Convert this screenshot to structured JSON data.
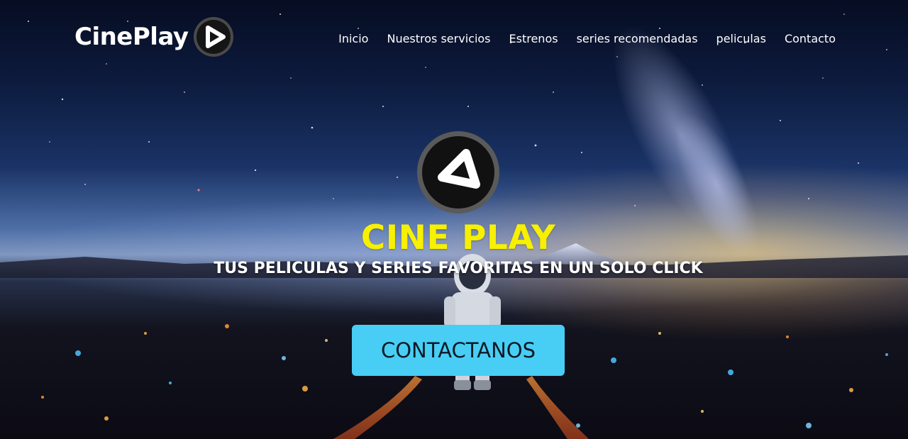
{
  "brand": {
    "name": "CinePlay",
    "logo_icon": "play-triangle-icon"
  },
  "nav": {
    "items": [
      {
        "label": "Inicio"
      },
      {
        "label": "Nuestros servicios"
      },
      {
        "label": "Estrenos"
      },
      {
        "label": "series recomendadas"
      },
      {
        "label": "peliculas"
      },
      {
        "label": "Contacto"
      }
    ]
  },
  "hero": {
    "title": "CINE PLAY",
    "subtitle": "TUS PELICULAS Y SERIES FAVORITAS EN UN SOLO CLICK",
    "cta_label": "CONTACTANOS"
  },
  "colors": {
    "title_yellow": "#f7f000",
    "cta_blue": "#48cef5",
    "text_white": "#ffffff"
  }
}
